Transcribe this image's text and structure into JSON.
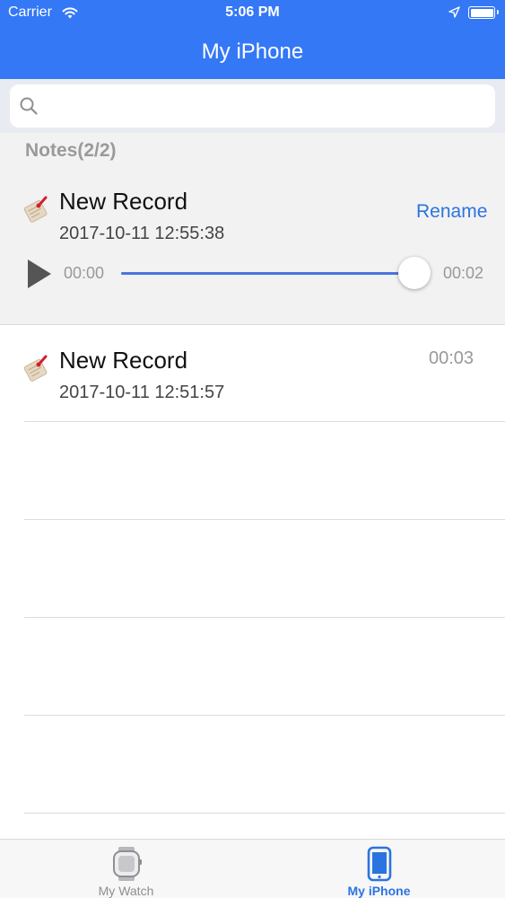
{
  "status_bar": {
    "carrier": "Carrier",
    "time": "5:06 PM"
  },
  "nav": {
    "title": "My iPhone"
  },
  "search": {
    "placeholder": "",
    "value": ""
  },
  "notes": {
    "count_label": "Notes(2/2)",
    "records": [
      {
        "title": "New Record",
        "date": "2017-10-11 12:55:38",
        "action": "Rename",
        "player": {
          "current": "00:00",
          "total": "00:02",
          "progress": 1.0
        }
      },
      {
        "title": "New Record",
        "date": "2017-10-11 12:51:57",
        "duration": "00:03"
      }
    ]
  },
  "tab_bar": {
    "tabs": [
      {
        "label": "My Watch",
        "active": false
      },
      {
        "label": "My iPhone",
        "active": true
      }
    ]
  },
  "colors": {
    "header": "#3478f6",
    "accent": "#2b74e0",
    "slider_fill": "#4b74e0",
    "tab_active": "#2b74e0",
    "tab_inactive": "#8e8e93"
  }
}
